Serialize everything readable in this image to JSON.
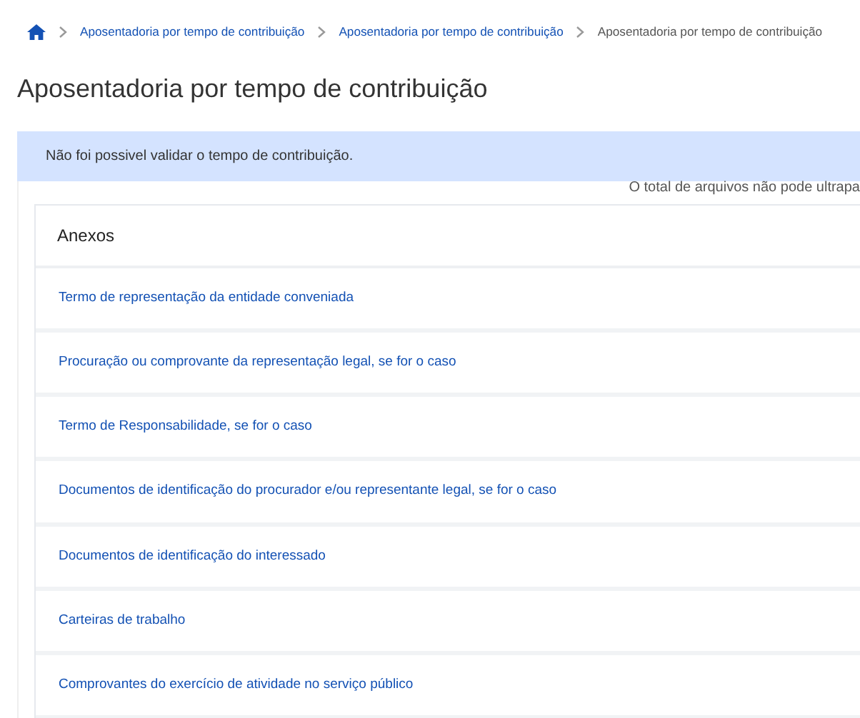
{
  "breadcrumb": [
    {
      "label": "Aposentadoria por tempo de contribuição",
      "kind": "link"
    },
    {
      "label": "Aposentadoria por tempo de contribuição",
      "kind": "link"
    },
    {
      "label": "Aposentadoria por tempo de contribuição",
      "kind": "current"
    }
  ],
  "page_title": "Aposentadoria por tempo de contribuição",
  "alert": "Não foi possivel validar o tempo de contribuição.",
  "note": "O total de arquivos não pode ultrapa",
  "attachments": {
    "title": "Anexos",
    "items": [
      "Termo de representação da entidade conveniada",
      "Procuração ou comprovante da representação legal, se for o caso",
      "Termo de Responsabilidade, se for o caso",
      "Documentos de identificação do procurador e/ou representante legal, se for o caso",
      "Documentos de identificação do interessado",
      "Carteiras de trabalho",
      "Comprovantes do exercício de atividade no serviço público"
    ]
  }
}
